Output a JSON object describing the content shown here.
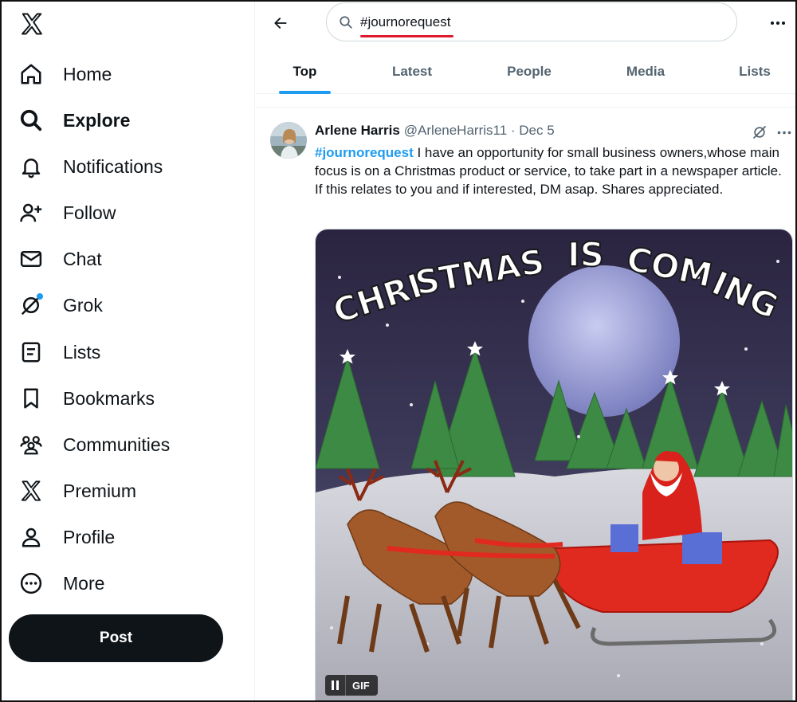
{
  "sidebar": {
    "items": [
      {
        "label": "Home",
        "icon": "home-icon"
      },
      {
        "label": "Explore",
        "icon": "search-icon"
      },
      {
        "label": "Notifications",
        "icon": "bell-icon"
      },
      {
        "label": "Follow",
        "icon": "follow-icon"
      },
      {
        "label": "Chat",
        "icon": "mail-icon"
      },
      {
        "label": "Grok",
        "icon": "grok-icon"
      },
      {
        "label": "Lists",
        "icon": "list-icon"
      },
      {
        "label": "Bookmarks",
        "icon": "bookmark-icon"
      },
      {
        "label": "Communities",
        "icon": "communities-icon"
      },
      {
        "label": "Premium",
        "icon": "x-logo-icon"
      },
      {
        "label": "Profile",
        "icon": "person-icon"
      },
      {
        "label": "More",
        "icon": "more-circle-icon"
      }
    ],
    "active": "Explore",
    "post_label": "Post"
  },
  "search": {
    "query": "#journorequest"
  },
  "tabs": [
    {
      "label": "Top"
    },
    {
      "label": "Latest"
    },
    {
      "label": "People"
    },
    {
      "label": "Media"
    },
    {
      "label": "Lists"
    }
  ],
  "active_tab": "Top",
  "tweet": {
    "author": "Arlene Harris",
    "handle": "@ArleneHarris11 · Dec 5",
    "hashtag": "#journorequest",
    "text": " I have an opportunity for small business owners,whose main focus is on a Christmas product or service, to take part in a newspaper article. If this relates to you and if interested, DM asap. Shares appreciated.",
    "media": {
      "type": "gif",
      "caption_text": "CHRISTMAS IS COMING",
      "badge": "GIF"
    }
  },
  "colors": {
    "accent": "#1d9bf0",
    "text": "#0f1419",
    "muted": "#536471",
    "highlight_underline": "#e0182d"
  }
}
